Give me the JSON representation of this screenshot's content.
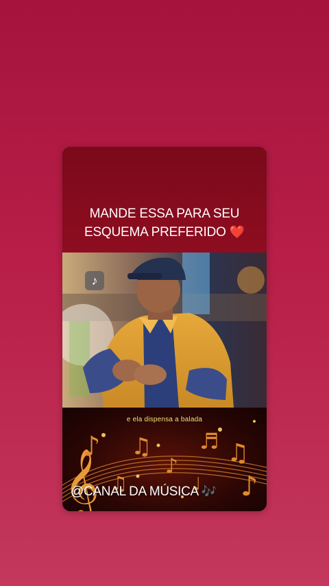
{
  "story": {
    "header_line1": "MANDE ESSA PARA SEU",
    "header_line2": "ESQUEMA PREFERIDO",
    "header_emoji": "❤️",
    "music_icon": "music-note-icon",
    "lyric": "e ela dispensa a balada",
    "channel_handle": "@CANAL DA MÚSICA",
    "channel_emoji": "🎶"
  },
  "colors": {
    "background": "#b81e48",
    "header_bg": "#8e0d20",
    "lyric_text": "#f3e27a",
    "accent_heart": "#e8233a"
  }
}
